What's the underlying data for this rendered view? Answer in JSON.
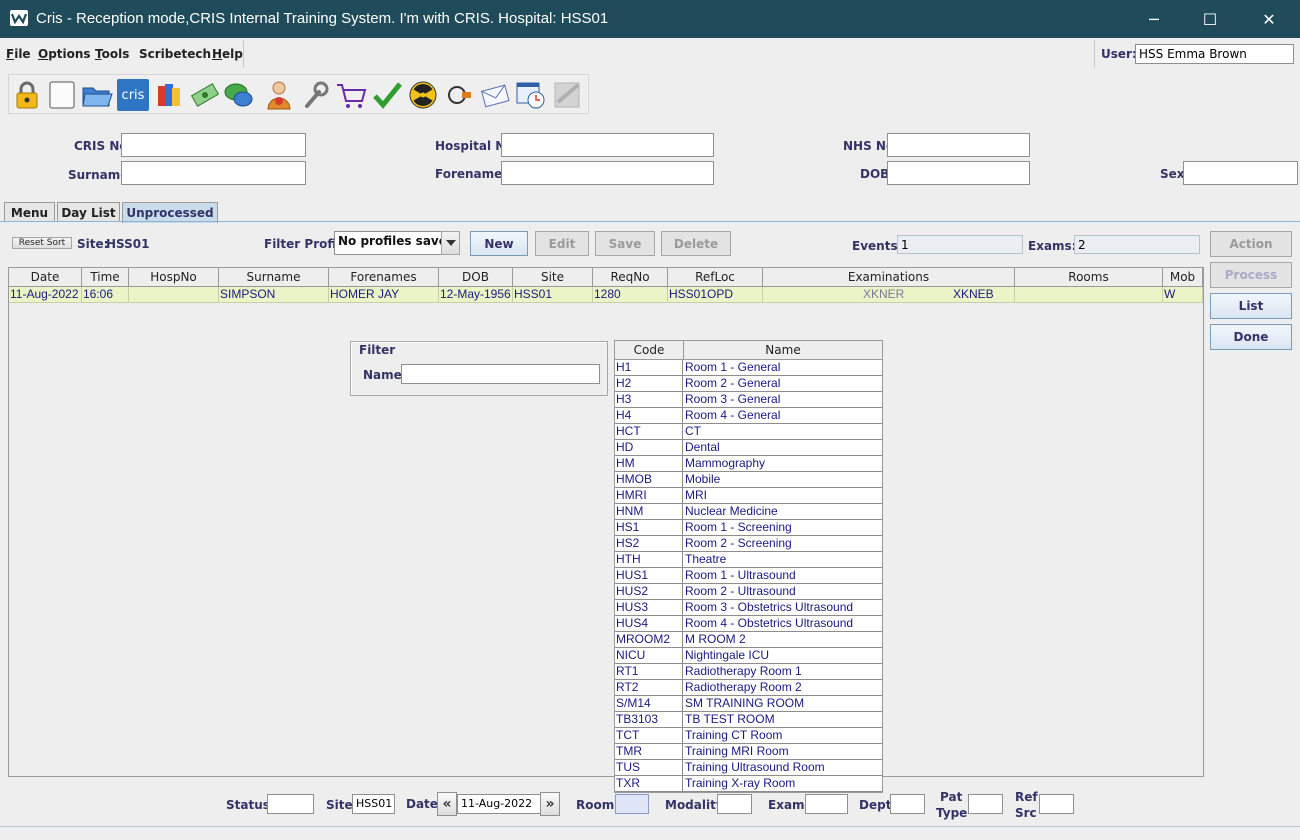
{
  "window": {
    "title": "Cris - Reception mode,CRIS Internal Training System. I'm with CRIS.   Hospital: HSS01",
    "minimize": "─",
    "maximize": "☐",
    "close": "✕"
  },
  "menu": {
    "items": [
      {
        "first": "F",
        "rest": "ile"
      },
      {
        "first": "O",
        "rest": "ptions"
      },
      {
        "first": "T",
        "rest": "ools"
      },
      {
        "first": "",
        "rest": "Scribetech"
      },
      {
        "first": "H",
        "rest": "elp"
      }
    ]
  },
  "user": {
    "label": "User:",
    "value": "HSS Emma Brown"
  },
  "toolbar": {
    "icons": [
      "lock-icon",
      "blank-page-icon",
      "open-folder-icon",
      "cris-icon",
      "books-icon",
      "money-icon",
      "chat-bubble-icon",
      "person-info-icon",
      "wrench-icon",
      "shopping-cart-icon",
      "checkmark-icon",
      "radiation-icon",
      "plug-icon",
      "envelope-icon",
      "clock-window-icon",
      "disabled-check-icon"
    ],
    "cris_label": "cris"
  },
  "search": {
    "cris_no": {
      "label": "CRIS No",
      "value": ""
    },
    "surname": {
      "label": "Surname",
      "value": ""
    },
    "hospital_no": {
      "label": "Hospital No",
      "value": ""
    },
    "forenames": {
      "label": "Forenames",
      "value": ""
    },
    "nhs_no": {
      "label": "NHS No",
      "value": ""
    },
    "dob": {
      "label": "DOB",
      "value": ""
    },
    "sex": {
      "label": "Sex",
      "value": ""
    }
  },
  "tabs": [
    {
      "label": "Menu",
      "active": false
    },
    {
      "label": "Day List",
      "active": false
    },
    {
      "label": "Unprocessed",
      "active": true
    }
  ],
  "list_toolbar": {
    "reset_sort": "Reset Sort",
    "site_label": "Site:",
    "site_value": "HSS01",
    "filter_profile_label": "Filter Profile",
    "filter_profile_value": "No profiles saved",
    "new": "New",
    "edit": "Edit",
    "save": "Save",
    "delete": "Delete",
    "events_label": "Events:",
    "events_value": "1",
    "exams_label": "Exams:",
    "exams_value": "2"
  },
  "side_buttons": {
    "action": "Action",
    "process": "Process",
    "list": "List",
    "done": "Done"
  },
  "grid": {
    "headers": [
      "Date",
      "Time",
      "HospNo",
      "Surname",
      "Forenames",
      "DOB",
      "Site",
      "ReqNo",
      "RefLoc",
      "Examinations",
      "Rooms",
      "Mob"
    ],
    "row": {
      "date": "11-Aug-2022",
      "time": "16:06",
      "hospno": "",
      "surname": "SIMPSON",
      "forenames": "HOMER JAY",
      "dob": "12-May-1956",
      "site": "HSS01",
      "reqno": "1280",
      "refloc": "HSS01OPD",
      "exam1": "XKNER",
      "exam2": "XKNEB",
      "rooms": "",
      "mob": "W"
    }
  },
  "filter": {
    "legend": "Filter",
    "name_label": "Name",
    "name_value": ""
  },
  "rooms": {
    "headers": [
      "Code",
      "Name"
    ],
    "rows": [
      [
        "H1",
        "Room 1 - General"
      ],
      [
        "H2",
        "Room 2 - General"
      ],
      [
        "H3",
        "Room 3 - General"
      ],
      [
        "H4",
        "Room 4 - General"
      ],
      [
        "HCT",
        "CT"
      ],
      [
        "HD",
        "Dental"
      ],
      [
        "HM",
        "Mammography"
      ],
      [
        "HMOB",
        "Mobile"
      ],
      [
        "HMRI",
        "MRI"
      ],
      [
        "HNM",
        "Nuclear Medicine"
      ],
      [
        "HS1",
        "Room 1 - Screening"
      ],
      [
        "HS2",
        "Room 2 - Screening"
      ],
      [
        "HTH",
        "Theatre"
      ],
      [
        "HUS1",
        "Room 1 - Ultrasound"
      ],
      [
        "HUS2",
        "Room 2 - Ultrasound"
      ],
      [
        "HUS3",
        "Room 3 - Obstetrics Ultrasound"
      ],
      [
        "HUS4",
        "Room 4 - Obstetrics Ultrasound"
      ],
      [
        "MROOM2",
        "M ROOM 2"
      ],
      [
        "NICU",
        "Nightingale ICU"
      ],
      [
        "RT1",
        "Radiotherapy Room 1"
      ],
      [
        "RT2",
        "Radiotherapy Room 2"
      ],
      [
        "S/M14",
        "SM TRAINING ROOM"
      ],
      [
        "TB3103",
        "TB TEST ROOM"
      ],
      [
        "TCT",
        "Training CT Room"
      ],
      [
        "TMR",
        "Training MRI Room"
      ],
      [
        "TUS",
        "Training Ultrasound Room"
      ],
      [
        "TXR",
        "Training X-ray Room"
      ]
    ]
  },
  "bottom": {
    "status_label": "Status",
    "status_value": "",
    "site_label": "Site",
    "site_value": "HSS01",
    "date_label": "Date",
    "date_value": "11-Aug-2022",
    "room_label": "Room",
    "room_value": "",
    "modality_label": "Modality",
    "modality_value": "",
    "exam_label": "Exam",
    "exam_value": "",
    "dept_label": "Dept",
    "dept_value": "",
    "pat_type_label_1": "Pat",
    "pat_type_label_2": "Type",
    "pat_type_value": "",
    "ref_src_label_1": "Ref",
    "ref_src_label_2": "Src",
    "ref_src_value": "",
    "prev_arrow": "«",
    "next_arrow": "»"
  },
  "colors": {
    "titlebar": "#1f4b5a",
    "label": "#333366",
    "row_highlight": "#eaf4c6",
    "row_text": "#1a1a80"
  }
}
